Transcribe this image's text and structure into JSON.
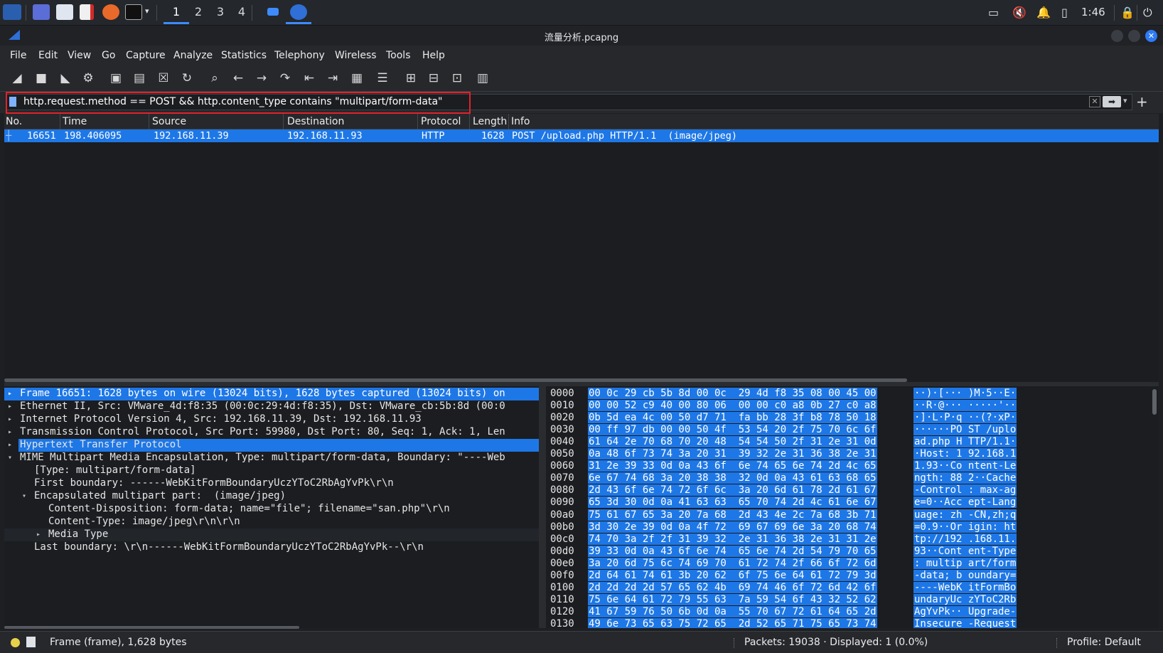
{
  "taskbar": {
    "workspaces": [
      "1",
      "2",
      "3",
      "4"
    ],
    "active_workspace": "1",
    "clock": "1:46"
  },
  "window": {
    "title": "流量分析.pcapng"
  },
  "menu": [
    "File",
    "Edit",
    "View",
    "Go",
    "Capture",
    "Analyze",
    "Statistics",
    "Telephony",
    "Wireless",
    "Tools",
    "Help"
  ],
  "filter": {
    "value": "http.request.method == POST && http.content_type contains \"multipart/form-data\"",
    "highlight_color": "#e3212b"
  },
  "packet_list": {
    "columns": [
      "No.",
      "Time",
      "Source",
      "Destination",
      "Protocol",
      "Length",
      "Info"
    ],
    "rows": [
      {
        "no": "16651",
        "time": "198.406095",
        "source": "192.168.11.39",
        "destination": "192.168.11.93",
        "protocol": "HTTP",
        "length": "1628",
        "info": "POST /upload.php HTTP/1.1  (image/jpeg)"
      }
    ],
    "selection_color": "#1e77e6"
  },
  "details": [
    "Frame 16651: 1628 bytes on wire (13024 bits), 1628 bytes captured (13024 bits) on",
    "Ethernet II, Src: VMware_4d:f8:35 (00:0c:29:4d:f8:35), Dst: VMware_cb:5b:8d (00:0",
    "Internet Protocol Version 4, Src: 192.168.11.39, Dst: 192.168.11.93",
    "Transmission Control Protocol, Src Port: 59980, Dst Port: 80, Seq: 1, Ack: 1, Len",
    "Hypertext Transfer Protocol",
    "MIME Multipart Media Encapsulation, Type: multipart/form-data, Boundary: \"----Web",
    "[Type: multipart/form-data]",
    "First boundary: ------WebKitFormBoundaryUczYToC2RbAgYvPk\\r\\n",
    "Encapsulated multipart part:  (image/jpeg)",
    "Content-Disposition: form-data; name=\"file\"; filename=\"san.php\"\\r\\n",
    "Content-Type: image/jpeg\\r\\n\\r\\n",
    "Media Type",
    "Last boundary: \\r\\n------WebKitFormBoundaryUczYToC2RbAgYvPk--\\r\\n"
  ],
  "hex": {
    "offsets": [
      "0000",
      "0010",
      "0020",
      "0030",
      "0040",
      "0050",
      "0060",
      "0070",
      "0080",
      "0090",
      "00a0",
      "00b0",
      "00c0",
      "00d0",
      "00e0",
      "00f0",
      "0100",
      "0110",
      "0120",
      "0130"
    ],
    "bytes": [
      "00 0c 29 cb 5b 8d 00 0c  29 4d f8 35 08 00 45 00",
      "00 00 52 c9 40 00 80 06  00 00 c0 a8 0b 27 c0 a8",
      "0b 5d ea 4c 00 50 d7 71  fa bb 28 3f b8 78 50 18",
      "00 ff 97 db 00 00 50 4f  53 54 20 2f 75 70 6c 6f",
      "61 64 2e 70 68 70 20 48  54 54 50 2f 31 2e 31 0d",
      "0a 48 6f 73 74 3a 20 31  39 32 2e 31 36 38 2e 31",
      "31 2e 39 33 0d 0a 43 6f  6e 74 65 6e 74 2d 4c 65",
      "6e 67 74 68 3a 20 38 38  32 0d 0a 43 61 63 68 65",
      "2d 43 6f 6e 74 72 6f 6c  3a 20 6d 61 78 2d 61 67",
      "65 3d 30 0d 0a 41 63 63  65 70 74 2d 4c 61 6e 67",
      "75 61 67 65 3a 20 7a 68  2d 43 4e 2c 7a 68 3b 71",
      "3d 30 2e 39 0d 0a 4f 72  69 67 69 6e 3a 20 68 74",
      "74 70 3a 2f 2f 31 39 32  2e 31 36 38 2e 31 31 2e",
      "39 33 0d 0a 43 6f 6e 74  65 6e 74 2d 54 79 70 65",
      "3a 20 6d 75 6c 74 69 70  61 72 74 2f 66 6f 72 6d",
      "2d 64 61 74 61 3b 20 62  6f 75 6e 64 61 72 79 3d",
      "2d 2d 2d 2d 57 65 62 4b  69 74 46 6f 72 6d 42 6f",
      "75 6e 64 61 72 79 55 63  7a 59 54 6f 43 32 52 62",
      "41 67 59 76 50 6b 0d 0a  55 70 67 72 61 64 65 2d",
      "49 6e 73 65 63 75 72 65  2d 52 65 71 75 65 73 74"
    ],
    "ascii": [
      "··)·[··· )M·5··E·",
      "··R·@··· ·····'··",
      "·]·L·P·q ··(?·xP·",
      "······PO ST /uplo",
      "ad.php H TTP/1.1·",
      "·Host: 1 92.168.1",
      "1.93··Co ntent-Le",
      "ngth: 88 2··Cache",
      "-Control : max-ag",
      "e=0··Acc ept-Lang",
      "uage: zh -CN,zh;q",
      "=0.9··Or igin: ht",
      "tp://192 .168.11.",
      "93··Cont ent-Type",
      ": multip art/form",
      "-data; b oundary=",
      "----WebK itFormBo",
      "undaryUc zYToC2Rb",
      "AgYvPk·· Upgrade-",
      "Insecure -Request"
    ]
  },
  "status": {
    "frame": "Frame (frame), 1,628 bytes",
    "packets": "Packets: 19038 · Displayed: 1 (0.0%)",
    "profile": "Profile: Default"
  }
}
